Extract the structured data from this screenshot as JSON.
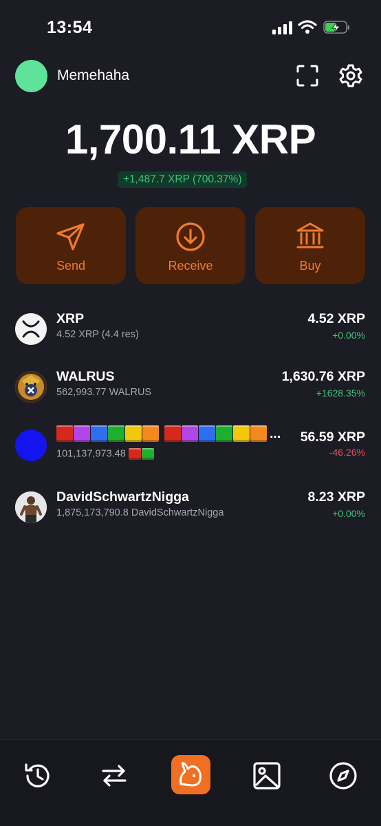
{
  "status_bar": {
    "time": "13:54"
  },
  "header": {
    "wallet_name": "Memehaha",
    "avatar_color": "#5fe39b"
  },
  "balance": {
    "amount": "1,700.11 XRP",
    "change": "+1,487.7 XRP (700.37%)"
  },
  "actions": [
    {
      "label": "Send",
      "icon": "send-icon"
    },
    {
      "label": "Receive",
      "icon": "receive-icon"
    },
    {
      "label": "Buy",
      "icon": "bank-icon"
    }
  ],
  "tokens": [
    {
      "name": "XRP",
      "sub": "4.52 XRP (4.4 res)",
      "value": "4.52 XRP",
      "change": "+0.00%",
      "icon": "xrp-logo-icon"
    },
    {
      "name": "WALRUS",
      "sub": "562,993.77 WALRUS",
      "value": "1,630.76 XRP",
      "change": "+1628.35%",
      "icon": "walrus-token-icon"
    },
    {
      "name_blocks": [
        "#d42a1e",
        "#b146e8",
        "#2f6ef0",
        "#1fae2e",
        "#f2c70c",
        "#f58a1c",
        "#d42a1e",
        "#b146e8",
        "#2f6ef0",
        "#1fae2e",
        "#f2c70c",
        "#f58a1c"
      ],
      "name_suffix": "...",
      "sub": "101,137,973.48",
      "sub_blocks": [
        "#d42a1e",
        "#1fae2e"
      ],
      "value": "56.59 XRP",
      "change": "-46.26%",
      "icon_color": "#1414f0"
    },
    {
      "name": "DavidSchwartzNigga",
      "sub": "1,875,173,790.8 DavidSchwartzNigga",
      "value": "8.23 XRP",
      "change": "+0.00%",
      "icon": "avatar-photo-icon"
    }
  ],
  "colors": {
    "accent": "#f07a2e",
    "positive": "#3fc07a",
    "negative": "#ef4d5a",
    "background": "#1c1c24"
  },
  "bottom_nav": [
    "history-icon",
    "swap-icon",
    "home-rabbit-icon",
    "gallery-icon",
    "compass-icon"
  ]
}
